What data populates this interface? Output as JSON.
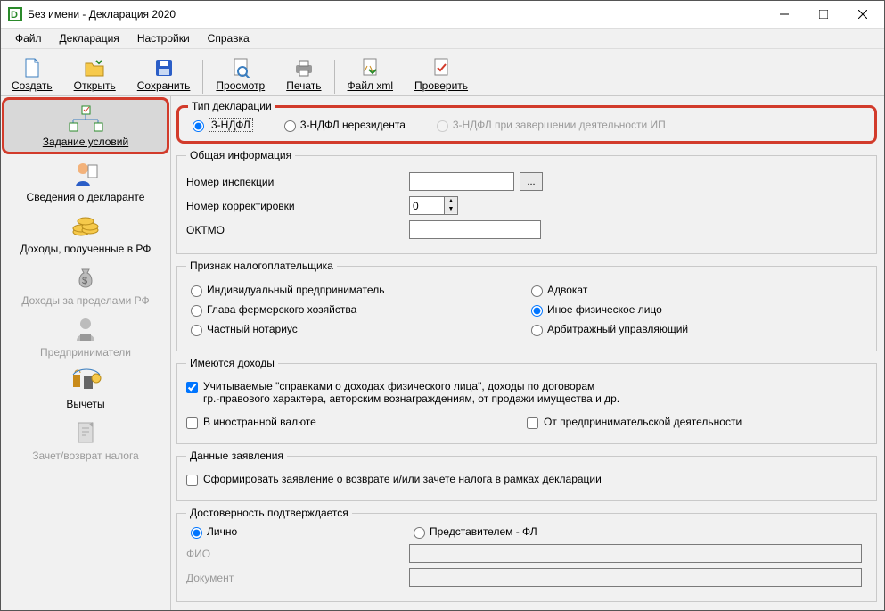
{
  "window": {
    "title": "Без имени - Декларация 2020"
  },
  "menu": {
    "file": "Файл",
    "decl": "Декларация",
    "settings": "Настройки",
    "help": "Справка"
  },
  "toolbar": {
    "create": "Создать",
    "open": "Открыть",
    "save": "Сохранить",
    "preview": "Просмотр",
    "print": "Печать",
    "xml": "Файл xml",
    "check": "Проверить"
  },
  "sidebar": {
    "conditions": "Задание условий",
    "declarant": "Сведения о декларанте",
    "income_rf": "Доходы, полученные в РФ",
    "income_fr": "Доходы за пределами РФ",
    "entrepreneurs": "Предприниматели",
    "deductions": "Вычеты",
    "refund": "Зачет/возврат налога"
  },
  "groups": {
    "type": {
      "legend": "Тип декларации",
      "opt1": "3-НДФЛ",
      "opt2": "3-НДФЛ нерезидента",
      "opt3": "3-НДФЛ при завершении деятельности ИП"
    },
    "general": {
      "legend": "Общая информация",
      "inspection": "Номер инспекции",
      "inspection_value": "",
      "browse": "...",
      "correction": "Номер корректировки",
      "correction_value": "0",
      "oktmo": "ОКТМО",
      "oktmo_value": ""
    },
    "taxpayer": {
      "legend": "Признак налогоплательщика",
      "ip": "Индивидуальный предприниматель",
      "lawyer": "Адвокат",
      "farm": "Глава фермерского хозяйства",
      "other": "Иное физическое лицо",
      "notary": "Частный нотариус",
      "arb": "Арбитражный управляющий"
    },
    "income": {
      "legend": "Имеются доходы",
      "main": "Учитываемые \"справками о доходах физического лица\", доходы по договорам\nгр.-правового характера, авторским вознаграждениям, от продажи имущества и др.",
      "foreign": "В иностранной валюте",
      "ent": "От предпринимательской деятельности"
    },
    "app": {
      "legend": "Данные заявления",
      "form": "Сформировать заявление о  возврате и/или зачете налога в рамках декларации"
    },
    "trust": {
      "legend": "Достоверность подтверждается",
      "self": "Лично",
      "rep": "Представителем - ФЛ",
      "fio": "ФИО",
      "doc": "Документ"
    }
  }
}
